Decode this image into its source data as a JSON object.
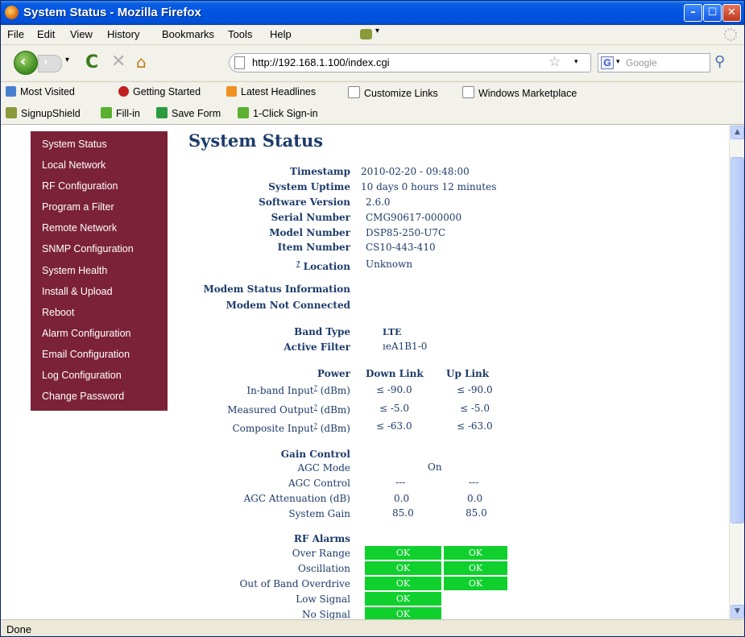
{
  "window": {
    "title": "System Status - Mozilla Firefox",
    "min_glyph": "–",
    "max_glyph": "☐",
    "close_glyph": "✕"
  },
  "menu": [
    "File",
    "Edit",
    "View",
    "History",
    "Bookmarks",
    "Tools",
    "Help"
  ],
  "nav": {
    "url": "http://192.168.1.100/index.cgi",
    "search_placeholder": "Google",
    "back_glyph": "‹",
    "forward_glyph": "›",
    "reload_glyph": "C",
    "stop_glyph": "✕",
    "home_glyph": "⌂",
    "star_glyph": "☆",
    "dropdown_glyph": "▾",
    "search_engine_glyph": "G",
    "search_button_glyph": "⚲"
  },
  "bookmarks": [
    "Most Visited",
    "Getting Started",
    "Latest Headlines",
    "Customize Links",
    "Windows Marketplace"
  ],
  "toolbar2": [
    "SignupShield",
    "Fill-in",
    "Save Form",
    "1-Click Sign-in"
  ],
  "sidebar": [
    "System Status",
    "Local Network",
    "RF Configuration",
    "Program a Filter",
    "Remote Network",
    "SNMP Configuration",
    "System Health",
    "Install & Upload",
    "Reboot",
    "Alarm Configuration",
    "Email Configuration",
    "Log Configuration",
    "Change Password"
  ],
  "page": {
    "title": "System Status",
    "info": {
      "timestamp_label": "Timestamp",
      "timestamp": "2010-02-20 - 09:48:00",
      "uptime_label": "System Uptime",
      "uptime": "10 days 0 hours 12 minutes",
      "software_label": "Software Version",
      "software": "2.6.0",
      "serial_label": "Serial Number",
      "serial": "CMG90617-000000",
      "model_label": "Model Number",
      "model": "DSP85-250-U7C",
      "item_label": "Item Number",
      "item": "CS10-443-410",
      "location_label": "Location",
      "location": "Unknown",
      "help_mark": "?"
    },
    "modem": {
      "status_heading": "Modem Status Information",
      "status": "Modem Not Connected"
    },
    "band": {
      "band_type_label": "Band Type",
      "band_type": "LTE",
      "active_filter_label": "Active Filter",
      "active_filter": "ıeA1B1-0"
    },
    "power": {
      "heading": "Power",
      "down_header": "Down Link",
      "up_header": "Up Link",
      "inband_label": "In-band Input",
      "inband_unit": "(dBm)",
      "inband_down": "≤ -90.0",
      "inband_up": "≤ -90.0",
      "measured_label": "Measured Output",
      "measured_unit": "(dBm)",
      "measured_down": "≤ -5.0",
      "measured_up": "≤ -5.0",
      "composite_label": "Composite Input",
      "composite_unit": "(dBm)",
      "composite_down": "≤ -63.0",
      "composite_up": "≤ -63.0"
    },
    "gain": {
      "heading": "Gain Control",
      "agc_mode_label": "AGC Mode",
      "agc_mode": "On",
      "agc_control_label": "AGC Control",
      "agc_control_down": "---",
      "agc_control_up": "---",
      "agc_atten_label": "AGC Attenuation (dB)",
      "agc_atten_down": "0.0",
      "agc_atten_up": "0.0",
      "system_gain_label": "System Gain",
      "system_gain_down": "85.0",
      "system_gain_up": "85.0"
    },
    "alarms": {
      "heading": "RF Alarms",
      "over_range_label": "Over Range",
      "over_range_down": "OK",
      "over_range_up": "OK",
      "oscillation_label": "Oscillation",
      "oscillation_down": "OK",
      "oscillation_up": "OK",
      "oob_label": "Out of Band Overdrive",
      "oob_down": "OK",
      "oob_up": "OK",
      "low_signal_label": "Low Signal",
      "low_signal_down": "OK",
      "no_signal_label": "No Signal",
      "no_signal_down": "OK"
    }
  },
  "status_bar": "Done",
  "colors": {
    "sidebar_bg": "#7b2238",
    "ok_green": "#10d02e",
    "text_navy": "#1d3b6b"
  }
}
